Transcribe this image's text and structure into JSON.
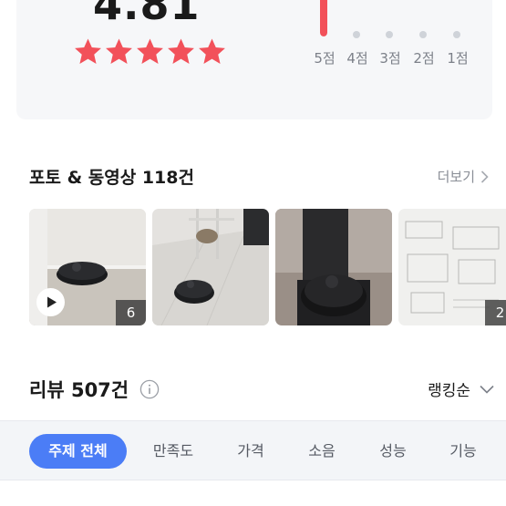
{
  "rating": {
    "average": "4.81",
    "stars_filled": 5,
    "star_color": "#f2515a",
    "distribution": [
      {
        "label": "5점",
        "fraction": 1.0
      },
      {
        "label": "4점",
        "fraction": 0.0
      },
      {
        "label": "3점",
        "fraction": 0.0
      },
      {
        "label": "2점",
        "fraction": 0.0
      },
      {
        "label": "1점",
        "fraction": 0.0
      }
    ]
  },
  "photos": {
    "title": "포토 & 동영상 118건",
    "more_label": "더보기",
    "items": [
      {
        "kind": "video",
        "count": "6",
        "icon": "play-icon"
      },
      {
        "kind": "photo",
        "count": ""
      },
      {
        "kind": "photo",
        "count": ""
      },
      {
        "kind": "photo",
        "count": "2"
      }
    ]
  },
  "reviews": {
    "title": "리뷰 507건",
    "info_icon": "info-icon",
    "sort_label": "랭킹순"
  },
  "topic_chips": [
    {
      "label": "주제 전체",
      "active": true
    },
    {
      "label": "만족도",
      "active": false
    },
    {
      "label": "가격",
      "active": false
    },
    {
      "label": "소음",
      "active": false
    },
    {
      "label": "성능",
      "active": false
    },
    {
      "label": "기능",
      "active": false
    }
  ],
  "colors": {
    "accent": "#4b7df6",
    "rating_red": "#f2515a"
  }
}
